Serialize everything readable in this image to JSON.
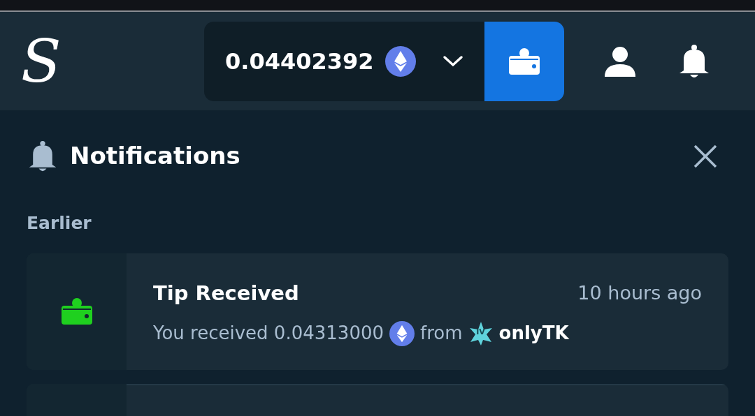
{
  "header": {
    "logo": "S",
    "balance": "0.04402392"
  },
  "panel": {
    "title": "Notifications",
    "section": "Earlier",
    "notifications": [
      {
        "title": "Tip Received",
        "time": "10 hours ago",
        "text": "You received 0.04313000",
        "from": "from",
        "level_badge": "IV",
        "user": "onlyTK"
      }
    ]
  }
}
